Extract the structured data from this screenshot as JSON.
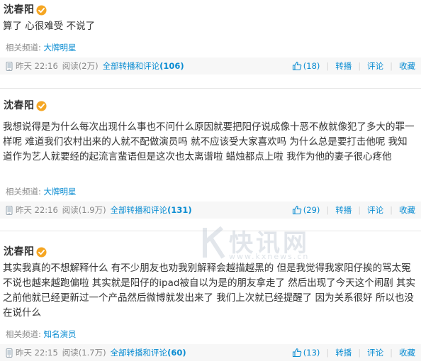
{
  "posts": [
    {
      "author": "沈春阳",
      "text": "算了 心很难受 不说了",
      "channel_label": "相关频道:",
      "channel": "大牌明星",
      "time": "昨天 22:16",
      "reads": "阅读(2万)",
      "all_reposts_label": "全部转播和评论",
      "all_reposts_count": "(106)",
      "likes": "(18)",
      "repost": "转播",
      "comment": "评论",
      "favorite": "收藏"
    },
    {
      "author": "沈春阳",
      "text": "我想说得是为什么每次出现什么事也不问什么原因就要把阳仔说成像十恶不赦就像犯了多大的罪一样呢 难道我们农村出来的人就不配做演员吗 就不应该受大家喜欢吗 为什么总是要打击他呢 我知道作为艺人就要经的起流言蜚语但是这次也太离谱啦 蜡烛都点上啦 我作为他的妻子很心疼他",
      "channel_label": "相关频道:",
      "channel": "大牌明星",
      "time": "昨天 22:16",
      "reads": "阅读(1.9万)",
      "all_reposts_label": "全部转播和评论",
      "all_reposts_count": "(131)",
      "likes": "(29)",
      "repost": "转播",
      "comment": "评论",
      "favorite": "收藏"
    },
    {
      "author": "沈春阳",
      "text": "其实我真的不想解释什么 有不少朋友也劝我别解释会越描越黑的 但是我觉得我家阳仔挨的骂太冤不说也越来越跑偏啦 其实就是阳仔的ipad被自以为是的朋友拿走了 然后出现了今天这个闹剧 其实之前他就已经更新过一个产品然后微博就发出来了 我们上次就已经提醒了 因为关系很好 所以也没在说什么",
      "channel_label": "相关频道:",
      "channel": "知名演员",
      "time": "昨天 22:15",
      "reads": "阅读(1.7万)",
      "all_reposts_label": "全部转播和评论",
      "all_reposts_count": "(60)",
      "likes": "(13)",
      "repost": "转播",
      "comment": "评论",
      "favorite": "收藏"
    }
  ],
  "watermark": {
    "main": "快讯网",
    "sub": "www.kxnews.cn"
  },
  "colors": {
    "link": "#0a8cd2",
    "meta_bg": "#f7f7f7",
    "badge": "#f5a623",
    "muted": "#888888"
  },
  "icons": {
    "verified": "verified-badge-icon",
    "phone": "phone-icon",
    "like": "thumbs-up-icon"
  }
}
